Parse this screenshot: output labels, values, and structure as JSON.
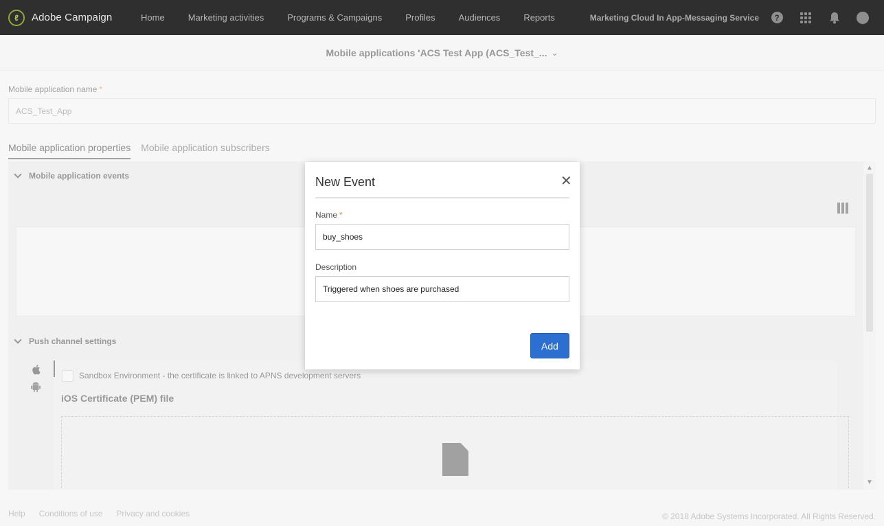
{
  "topbar": {
    "brand_logo_glyph": "ℓ",
    "brand_name": "Adobe Campaign",
    "nav": [
      "Home",
      "Marketing activities",
      "Programs & Campaigns",
      "Profiles",
      "Audiences",
      "Reports"
    ],
    "service_name": "Marketing Cloud In App-Messaging Service",
    "help_glyph": "?",
    "icons": [
      "help-icon",
      "apps-grid-icon",
      "bell-icon",
      "avatar"
    ]
  },
  "page": {
    "title": "Mobile applications 'ACS Test App (ACS_Test_...",
    "title_chevron": "⌄"
  },
  "form": {
    "app_name_label": "Mobile application name",
    "required_mark": "*",
    "app_name_value": "ACS_Test_App"
  },
  "tabs": [
    {
      "label": "Mobile application properties",
      "active": true
    },
    {
      "label": "Mobile application subscribers",
      "active": false
    }
  ],
  "sections": {
    "events": "Mobile application events",
    "push": "Push channel settings",
    "sandbox_label": "Sandbox Environment - the certificate is linked to APNS development servers",
    "cert_title": "iOS Certificate (PEM) file"
  },
  "scrollbar": {
    "up_glyph": "▲",
    "down_glyph": "▼"
  },
  "footer": {
    "links": [
      "Help",
      "Conditions of use",
      "Privacy and cookies"
    ],
    "copyright": "© 2018 Adobe Systems Incorporated. All Rights Reserved."
  },
  "modal": {
    "title": "New Event",
    "close_glyph": "✕",
    "name_label": "Name",
    "required_mark": "*",
    "name_value": "buy_shoes",
    "description_label": "Description",
    "description_value": "Triggered when shoes are purchased",
    "add_label": "Add"
  },
  "colors": {
    "topbar": "#2f2f2f",
    "primary_button": "#2d6fd0",
    "required": "#e68619"
  }
}
